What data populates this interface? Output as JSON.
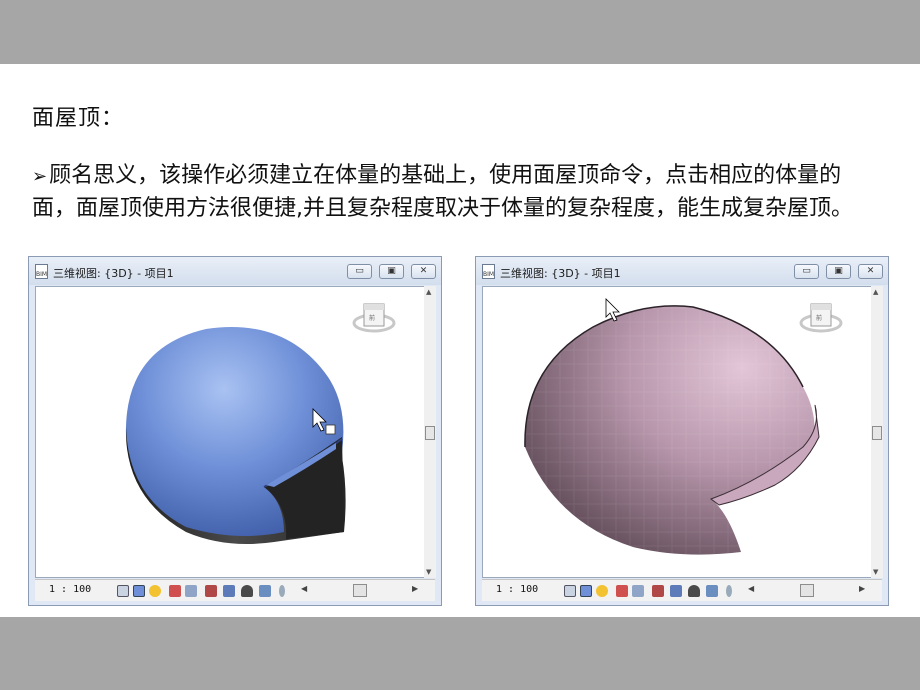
{
  "slide": {
    "heading": "面屋顶：",
    "bullet": "➢",
    "paragraph": "顾名思义，该操作必须建立在体量的基础上，使用面屋顶命令，点击相应的体量的面，面屋顶使用方法很便捷,并且复杂程度取决于体量的复杂程度，能生成复杂屋顶。"
  },
  "windows": [
    {
      "title": "三维视图: {3D} - 项目1",
      "app_icon": "BIM",
      "controls": [
        "minimize-icon",
        "restore-icon",
        "close-icon"
      ],
      "scale": "1 : 100",
      "mass_color": "#6d8fd6",
      "viewcube": "viewcube-icon"
    },
    {
      "title": "三维视图: {3D} - 项目1",
      "app_icon": "BIM",
      "controls": [
        "minimize-icon",
        "restore-icon",
        "close-icon"
      ],
      "scale": "1 : 100",
      "roof_color": "#b89aae",
      "viewcube": "viewcube-icon"
    }
  ],
  "colors": {
    "band": "#a6a6a6",
    "mass_blue": "#6d8fd6",
    "mass_dark": "#2e2e2e",
    "roof_pink": "#b89aae"
  }
}
